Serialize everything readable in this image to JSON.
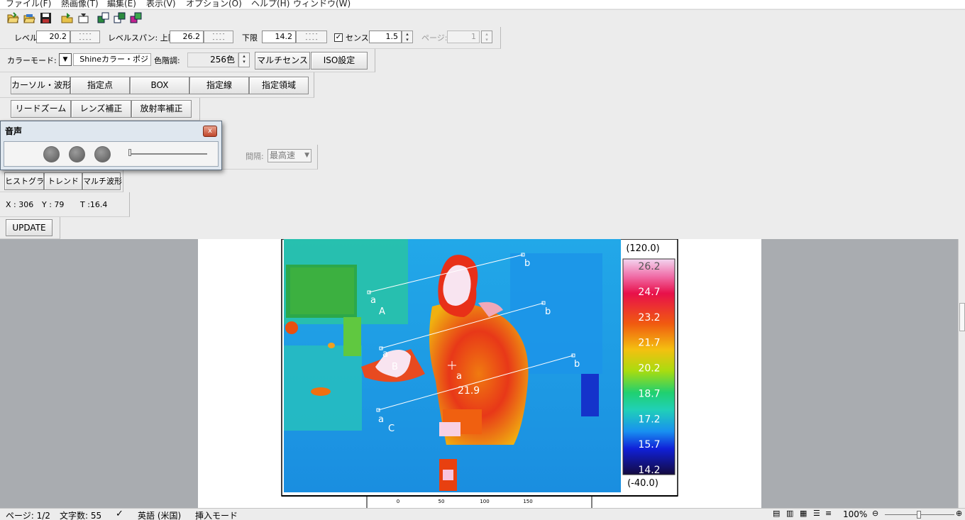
{
  "menu": [
    "ファイル(F)",
    "熱画像(T)",
    "編集(E)",
    "表示(V)",
    "オプション(O)",
    "ヘルプ(H)",
    "ウィンドウ(W)"
  ],
  "toolbar_icons": [
    "open-folder-icon",
    "open-folder-multi-icon",
    "save-disk-icon",
    "load-icon",
    "export-icon",
    "window-tile-icon",
    "window-copy-icon",
    "window-color-icon"
  ],
  "level_row": {
    "level_label": "レベル:",
    "level_value": "20.2",
    "span_label": "レベルスパン: 上限",
    "upper_value": "26.2",
    "lower_label": "下限",
    "lower_value": "14.2",
    "sense_label": "センス:",
    "sense_value": "1.5",
    "page_label": "ページ:",
    "page_value": "1"
  },
  "color_row": {
    "mode_label": "カラーモード:",
    "mode_value": "Shineカラー・ポジ",
    "tone_label": "色階調:",
    "tone_value": "256色",
    "multi_sense_button": "マルチセンス",
    "iso_button": "ISO設定"
  },
  "cursor_row": [
    "カーソル・波形",
    "指定点",
    "BOX",
    "指定線",
    "指定領域"
  ],
  "zoom_row": [
    "リードズーム",
    "レンズ補正",
    "放射率補正"
  ],
  "interval": {
    "label": "間隔:",
    "value": "最高速"
  },
  "analysis_row": [
    "ヒストグラム",
    "トレンド",
    "マルチ波形"
  ],
  "coords": {
    "x": "X : 306",
    "y": "Y : 79",
    "t": "T :16.4"
  },
  "update_button": "UPDATE",
  "dialog": {
    "title": "音声",
    "close": "x"
  },
  "thermal": {
    "scale_max": "(120.0)",
    "scale_min": "(-40.0)",
    "scale_labels": [
      "26.2",
      "24.7",
      "23.2",
      "21.7",
      "20.2",
      "18.7",
      "17.2",
      "15.7",
      "14.2"
    ],
    "line_a_start": "a",
    "line_a_end": "b",
    "line_a_name": "A",
    "line_b_start": "a",
    "line_b_end": "b",
    "line_b_name": "B",
    "line_c_start": "a",
    "line_c_end": "b",
    "line_c_name": "C",
    "cursor_label": "a",
    "cursor_value": "21.9",
    "ruler_labels": [
      "0",
      "50",
      "100",
      "150"
    ]
  },
  "statusbar": {
    "page": "ページ: 1/2",
    "chars": "文字数: 55",
    "lang": "英語 (米国)",
    "mode": "挿入モード",
    "zoom": "100%"
  }
}
